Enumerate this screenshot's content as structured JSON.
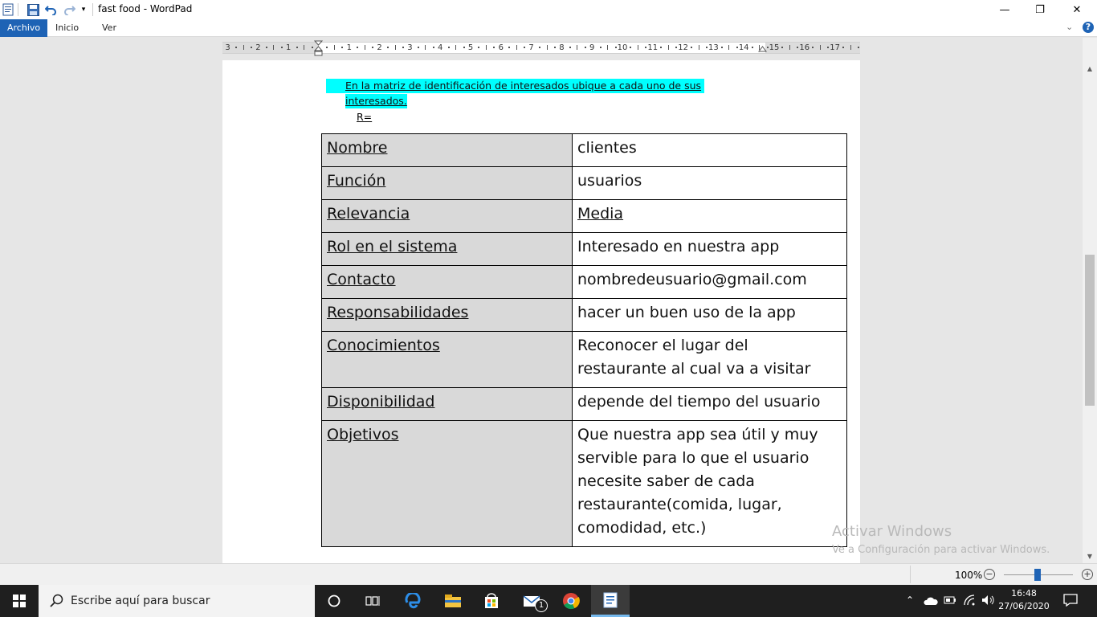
{
  "window": {
    "title": "fast food - WordPad",
    "minimize": "—",
    "maximize": "❐",
    "close": "✕"
  },
  "ribbon": {
    "tabs": [
      "Archivo",
      "Inicio",
      "Ver"
    ],
    "active_tab": "Archivo",
    "collapse_glyph": "⌄",
    "help_glyph": "?"
  },
  "ruler": {
    "numbers": [
      "3",
      "2",
      "1",
      "1",
      "2",
      "3",
      "4",
      "5",
      "6",
      "7",
      "8",
      "9",
      "10",
      "11",
      "12",
      "13",
      "14",
      "15",
      "16",
      "17"
    ]
  },
  "document": {
    "bullet_line1": "En la matriz de identificación de interesados ubique a cada uno de sus",
    "bullet_line2": "interesados.",
    "answer_label": "R=",
    "rows": [
      {
        "key": "Nombre",
        "value": "clientes"
      },
      {
        "key": "Función",
        "value": "usuarios"
      },
      {
        "key": "Relevancia",
        "value": "Media"
      },
      {
        "key": "Rol en el sistema",
        "value": "Interesado en nuestra app"
      },
      {
        "key": "Contacto",
        "value": "nombredeusuario@gmail.com"
      },
      {
        "key": "Responsabilidades",
        "value": "hacer un buen uso de la app"
      },
      {
        "key": "Conocimientos",
        "value": "Reconocer el lugar del restaurante al cual va a visitar"
      },
      {
        "key": "Disponibilidad",
        "value": "depende del tiempo del usuario"
      },
      {
        "key": "Objetivos",
        "value": "Que nuestra app sea útil y muy servible para lo que el usuario necesite saber de cada restaurante(comida, lugar, comodidad, etc.)"
      }
    ]
  },
  "watermark": {
    "line1": "Activar Windows",
    "line2": "Ve a Configuración para activar Windows."
  },
  "statusbar": {
    "zoom": "100%",
    "zoom_minus": "−",
    "zoom_plus": "+"
  },
  "taskbar": {
    "search_placeholder": "Escribe aquí para buscar",
    "mail_badge": "1",
    "time": "16:48",
    "date": "27/06/2020"
  }
}
